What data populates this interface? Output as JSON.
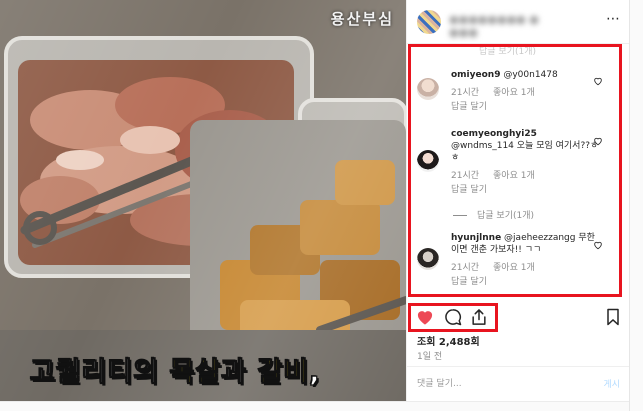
{
  "media": {
    "watermark": "용산부심",
    "caption_white_1": "고퀄리티의 ",
    "caption_yellow_1": "목살",
    "caption_white_2": "과 ",
    "caption_yellow_2": "갈비",
    "caption_white_3": ","
  },
  "header": {
    "username_blurred": "●●●●●●●● ● ●●●",
    "more_icon": "⋯"
  },
  "faded_above": "답글 보기(1개)",
  "comments": [
    {
      "username": "omiyeon9",
      "text": " @y00n1478",
      "time": "21시간",
      "likes": "좋아요 1개",
      "reply": "답글 달기"
    },
    {
      "username": "coemyeonghyi25",
      "text": " @wndms_114 오늘 모임 여기서??ㅎㅎ",
      "time": "21시간",
      "likes": "좋아요 1개",
      "reply": "답글 달기"
    },
    {
      "username": "hyunjlnne",
      "text": " @jaeheezzangg 무한이면 갠춘 가보자!! ㄱㄱ",
      "time": "21시간",
      "likes": "좋아요 1개",
      "reply": "답글 달기"
    }
  ],
  "view_replies": "답글 보기(1개)",
  "actions": {
    "like_icon": "heart-filled",
    "comment_icon": "speech-bubble",
    "share_icon": "share-upload",
    "save_icon": "bookmark",
    "like_color": "#ed4956"
  },
  "views": "조회 2,488회",
  "posted": "1일 전",
  "add_comment": {
    "placeholder": "댓글 달기...",
    "post_label": "게시"
  },
  "highlight_color": "#e8141f"
}
